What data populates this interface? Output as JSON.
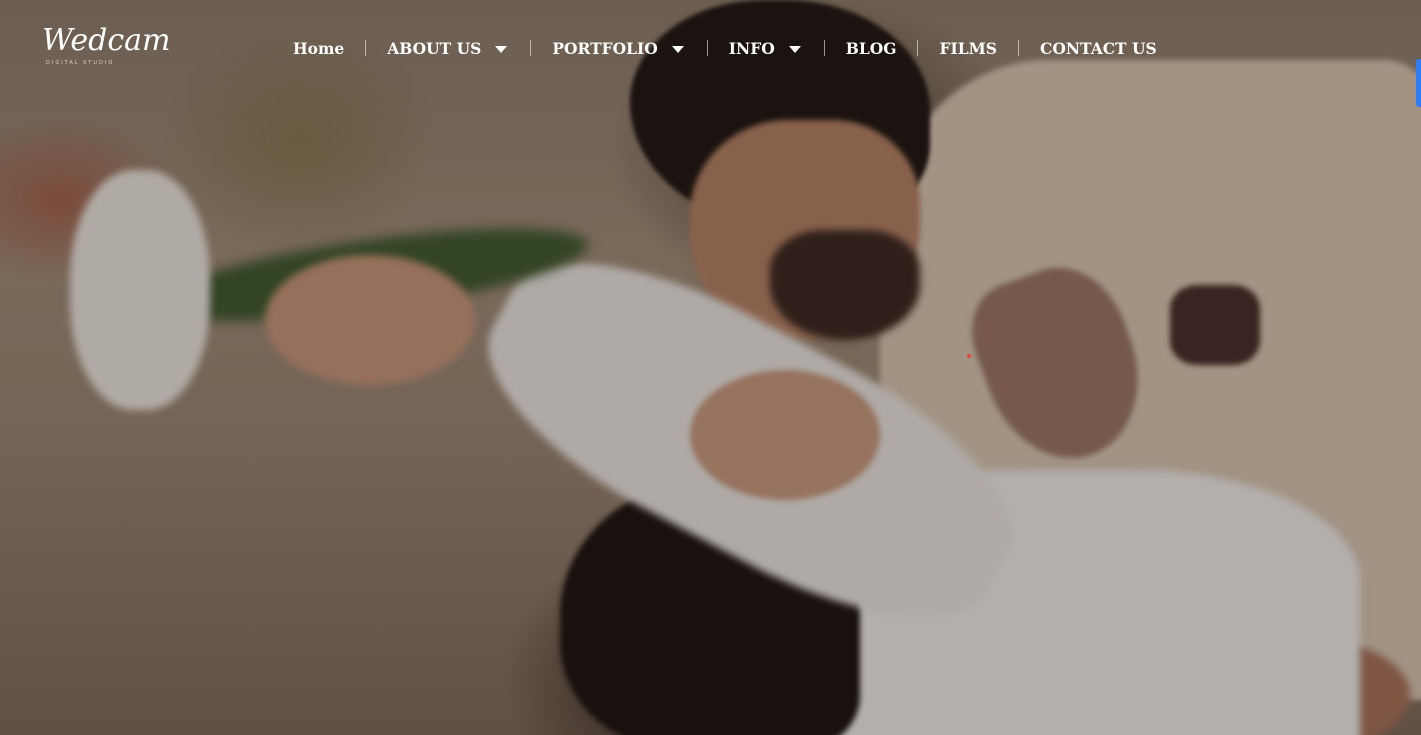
{
  "brand": {
    "logo_text": "Wedcam",
    "logo_subtitle": "DIGITAL STUDIO"
  },
  "nav": {
    "items": [
      {
        "label": "Home",
        "has_dropdown": false
      },
      {
        "label": "ABOUT US",
        "has_dropdown": true
      },
      {
        "label": "PORTFOLIO",
        "has_dropdown": true
      },
      {
        "label": "INFO",
        "has_dropdown": true
      },
      {
        "label": "BLOG",
        "has_dropdown": false
      },
      {
        "label": "FILMS",
        "has_dropdown": false
      },
      {
        "label": "CONTACT US",
        "has_dropdown": false
      }
    ],
    "dropdown_icon": "caret-down-icon",
    "text_color": "#ffffff"
  },
  "hero": {
    "image_subject": "wedding couple hero photo",
    "overlay_color": "#140e0c"
  },
  "side_tab": {
    "color": "#2f7cf6"
  }
}
